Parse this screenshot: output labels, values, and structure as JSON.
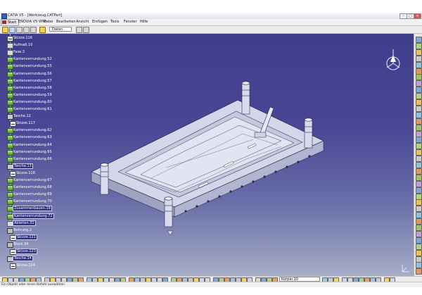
{
  "window": {
    "title": "CATIA V5 - [Werkzeug.CATPart]"
  },
  "menubar": {
    "start": "Start",
    "items": [
      "ENOVIA V5 VPM",
      "Datei",
      "Bearbeiten",
      "Ansicht",
      "Einfügen",
      "Tools",
      "Fenster",
      "Hilfe"
    ]
  },
  "toolbar": {
    "combo_value": "Daten"
  },
  "tree": {
    "items": [
      {
        "label": "Skizze.116",
        "icon": "sketch-icon",
        "highlight": false
      },
      {
        "label": "Aufmaß.10",
        "icon": "feature-icon",
        "highlight": false
      },
      {
        "label": "Fase.3",
        "icon": "chamfer-icon",
        "highlight": false
      },
      {
        "label": "Kantenverrundung.52",
        "icon": "edge-fillet-icon",
        "highlight": false
      },
      {
        "label": "Kantenverrundung.55",
        "icon": "edge-fillet-icon",
        "highlight": false
      },
      {
        "label": "Kantenverrundung.56",
        "icon": "edge-fillet-icon",
        "highlight": false
      },
      {
        "label": "Kantenverrundung.57",
        "icon": "edge-fillet-icon",
        "highlight": false
      },
      {
        "label": "Kantenverrundung.58",
        "icon": "edge-fillet-icon",
        "highlight": false
      },
      {
        "label": "Kantenverrundung.59",
        "icon": "edge-fillet-icon",
        "highlight": false
      },
      {
        "label": "Kantenverrundung.60",
        "icon": "edge-fillet-icon",
        "highlight": false
      },
      {
        "label": "Kantenverrundung.61",
        "icon": "edge-fillet-icon",
        "highlight": false
      },
      {
        "label": "Tasche.12",
        "icon": "pocket-icon",
        "highlight": false
      },
      {
        "label": "Skizze.117",
        "icon": "sketch-icon",
        "highlight": false
      },
      {
        "label": "Kantenverrundung.62",
        "icon": "edge-fillet-icon",
        "highlight": false
      },
      {
        "label": "Kantenverrundung.63",
        "icon": "edge-fillet-icon",
        "highlight": false
      },
      {
        "label": "Kantenverrundung.64",
        "icon": "edge-fillet-icon",
        "highlight": false
      },
      {
        "label": "Kantenverrundung.65",
        "icon": "edge-fillet-icon",
        "highlight": false
      },
      {
        "label": "Kantenverrundung.66",
        "icon": "edge-fillet-icon",
        "highlight": false
      },
      {
        "label": "Tasche.13",
        "icon": "pocket-icon",
        "highlight": true
      },
      {
        "label": "Skizze.118",
        "icon": "sketch-icon",
        "highlight": false
      },
      {
        "label": "Kantenverrundung.67",
        "icon": "edge-fillet-icon",
        "highlight": false
      },
      {
        "label": "Kantenverrundung.68",
        "icon": "edge-fillet-icon",
        "highlight": false
      },
      {
        "label": "Kantenverrundung.69",
        "icon": "edge-fillet-icon",
        "highlight": false
      },
      {
        "label": "Kantenverrundung.70",
        "icon": "edge-fillet-icon",
        "highlight": false
      },
      {
        "label": "Zusammenbauen.19",
        "icon": "assemble-icon",
        "highlight": true
      },
      {
        "label": "Kantenverrundung.72",
        "icon": "edge-fillet-icon",
        "highlight": true
      },
      {
        "label": "Ableiten.31",
        "icon": "draft-icon",
        "highlight": true
      },
      {
        "label": "Bohrung.2",
        "icon": "hole-icon",
        "highlight": false
      },
      {
        "label": "Skizze.121",
        "icon": "sketch-icon",
        "highlight": true
      },
      {
        "label": "Block.34",
        "icon": "pad-icon",
        "highlight": false
      },
      {
        "label": "Skizze.123",
        "icon": "sketch-icon",
        "highlight": true
      },
      {
        "label": "Tasche.14",
        "icon": "pocket-icon",
        "highlight": true
      },
      {
        "label": "Skizze.124",
        "icon": "sketch-icon",
        "highlight": false
      }
    ]
  },
  "bottom_toolbar": {
    "combo_value": "Körper.10"
  },
  "statusbar": {
    "text": "Ein Objekt oder einen Befehl auswählen"
  },
  "colors": {
    "viewport_top": "#3e3c8c",
    "viewport_bottom": "#a6aec8",
    "tree_text": "#ffffff",
    "part": "#c9cbe0"
  }
}
